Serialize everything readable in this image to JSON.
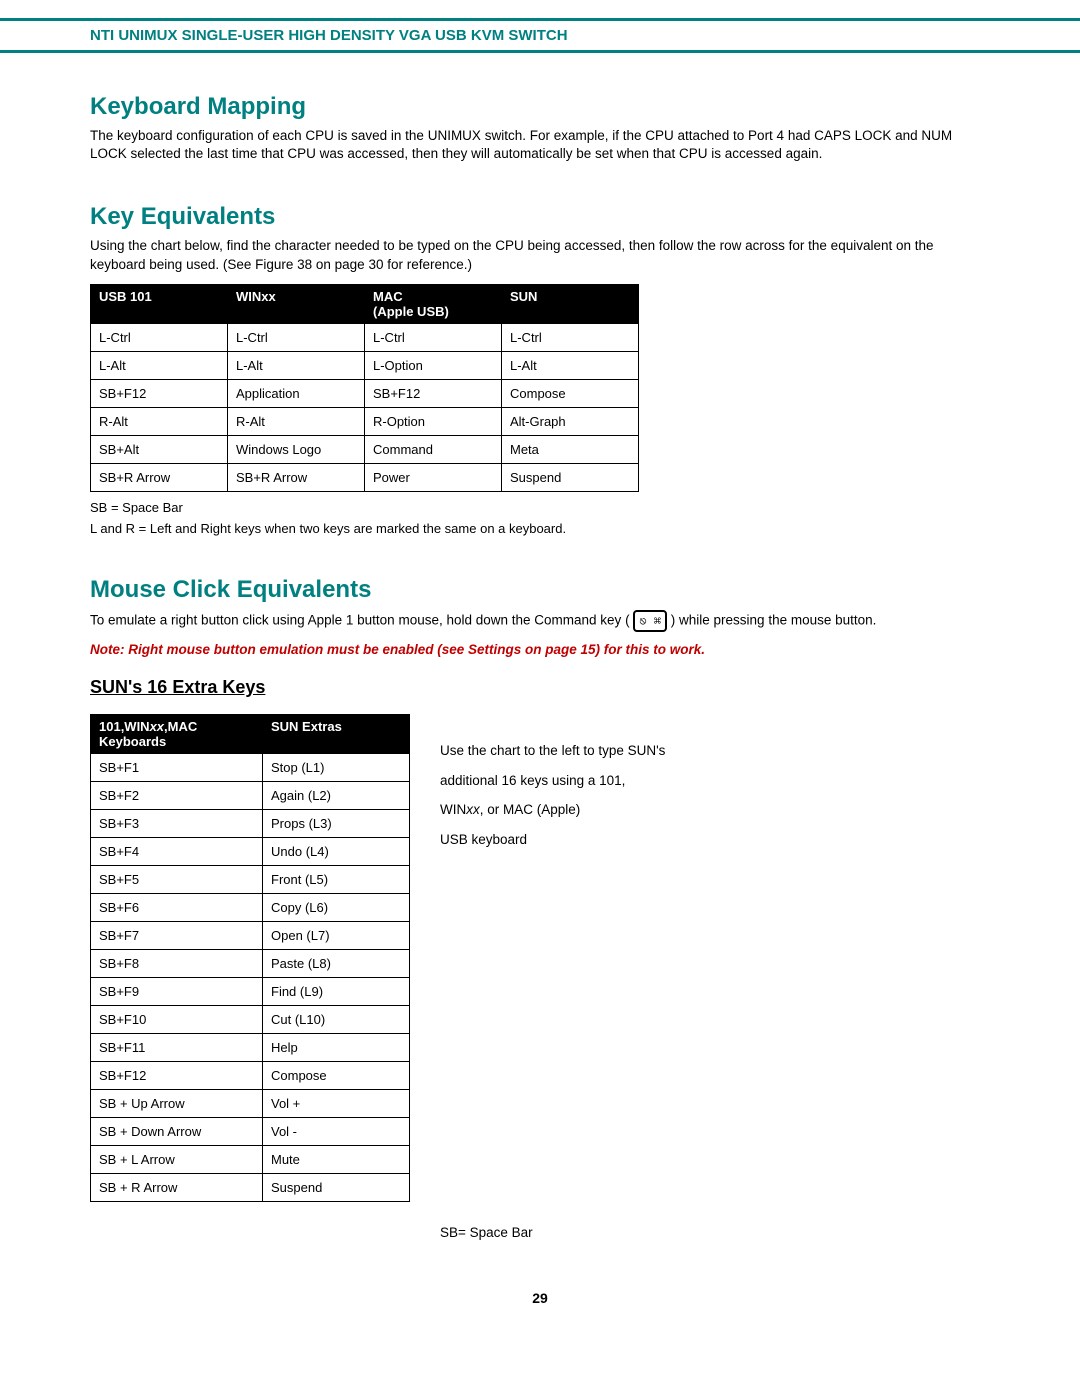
{
  "header": "NTI UNIMUX SINGLE-USER HIGH DENSITY VGA USB KVM SWITCH",
  "section1": {
    "title": "Keyboard Mapping",
    "text": "The keyboard configuration of each CPU is saved in the UNIMUX switch.  For example, if the CPU attached to Port 4 had CAPS LOCK and NUM LOCK selected the last time that CPU was accessed, then they will automatically be set when that CPU is accessed again."
  },
  "section2": {
    "title": "Key Equivalents",
    "text": "Using the chart below, find the character needed to be typed on the CPU being accessed, then follow the row across for the equivalent on the keyboard being used.   (See Figure 38 on page 30 for reference.)",
    "table": {
      "headers": {
        "c1": "USB 101",
        "c2": "WINxx",
        "c3a": "MAC",
        "c3b": "(Apple USB)",
        "c4": "SUN"
      },
      "rows": [
        {
          "c1": "L-Ctrl",
          "c2": "L-Ctrl",
          "c3": "L-Ctrl",
          "c4": "L-Ctrl"
        },
        {
          "c1": "L-Alt",
          "c2": "L-Alt",
          "c3": "L-Option",
          "c4": "L-Alt"
        },
        {
          "c1": "SB+F12",
          "c2": "Application",
          "c3": "SB+F12",
          "c4": "Compose"
        },
        {
          "c1": "R-Alt",
          "c2": "R-Alt",
          "c3": "R-Option",
          "c4": "Alt-Graph"
        },
        {
          "c1": "SB+Alt",
          "c2": "Windows Logo",
          "c3": "Command",
          "c4": "Meta"
        },
        {
          "c1": "SB+R Arrow",
          "c2": "SB+R Arrow",
          "c3": "Power",
          "c4": "Suspend"
        }
      ]
    },
    "legend1": "SB = Space Bar",
    "legend2": "L and R = Left and Right keys when two keys are marked the same on a keyboard."
  },
  "section3": {
    "title": "Mouse Click Equivalents",
    "text_pre": "To emulate a right button click using Apple 1 button mouse, hold down the Command key (",
    "text_post": ") while pressing the mouse button.",
    "icon_glyphs": "⎋ ⌘",
    "note": "Note: Right mouse button emulation must be enabled (see Settings on page 15) for this to work."
  },
  "section4": {
    "title": "SUN's 16 Extra Keys",
    "table": {
      "headers": {
        "c1a": "101,WIN",
        "c1b": "xx",
        "c1c": ",MAC",
        "c1d": "Keyboards",
        "c2": "SUN Extras"
      },
      "rows": [
        {
          "c1": "SB+F1",
          "c2": "Stop (L1)"
        },
        {
          "c1": "SB+F2",
          "c2": "Again (L2)"
        },
        {
          "c1": "SB+F3",
          "c2": "Props (L3)"
        },
        {
          "c1": "SB+F4",
          "c2": "Undo (L4)"
        },
        {
          "c1": "SB+F5",
          "c2": "Front (L5)"
        },
        {
          "c1": "SB+F6",
          "c2": "Copy (L6)"
        },
        {
          "c1": "SB+F7",
          "c2": "Open (L7)"
        },
        {
          "c1": "SB+F8",
          "c2": "Paste (L8)"
        },
        {
          "c1": "SB+F9",
          "c2": "Find (L9)"
        },
        {
          "c1": "SB+F10",
          "c2": "Cut (L10)"
        },
        {
          "c1": "SB+F11",
          "c2": "Help"
        },
        {
          "c1": "SB+F12",
          "c2": "Compose"
        },
        {
          "c1": "SB + Up Arrow",
          "c2": "Vol +"
        },
        {
          "c1": "SB + Down Arrow",
          "c2": "Vol -"
        },
        {
          "c1": "SB + L Arrow",
          "c2": "Mute"
        },
        {
          "c1": "SB + R Arrow",
          "c2": "Suspend"
        }
      ]
    },
    "side_text": {
      "l1": "Use the chart to the left to type SUN's",
      "l2": "additional 16 keys using a 101,",
      "l3_pre": "WIN",
      "l3_it": "xx",
      "l3_post": ",  or MAC (Apple)",
      "l4": "USB keyboard"
    },
    "bottom_note": "SB= Space Bar"
  },
  "page_number": "29"
}
